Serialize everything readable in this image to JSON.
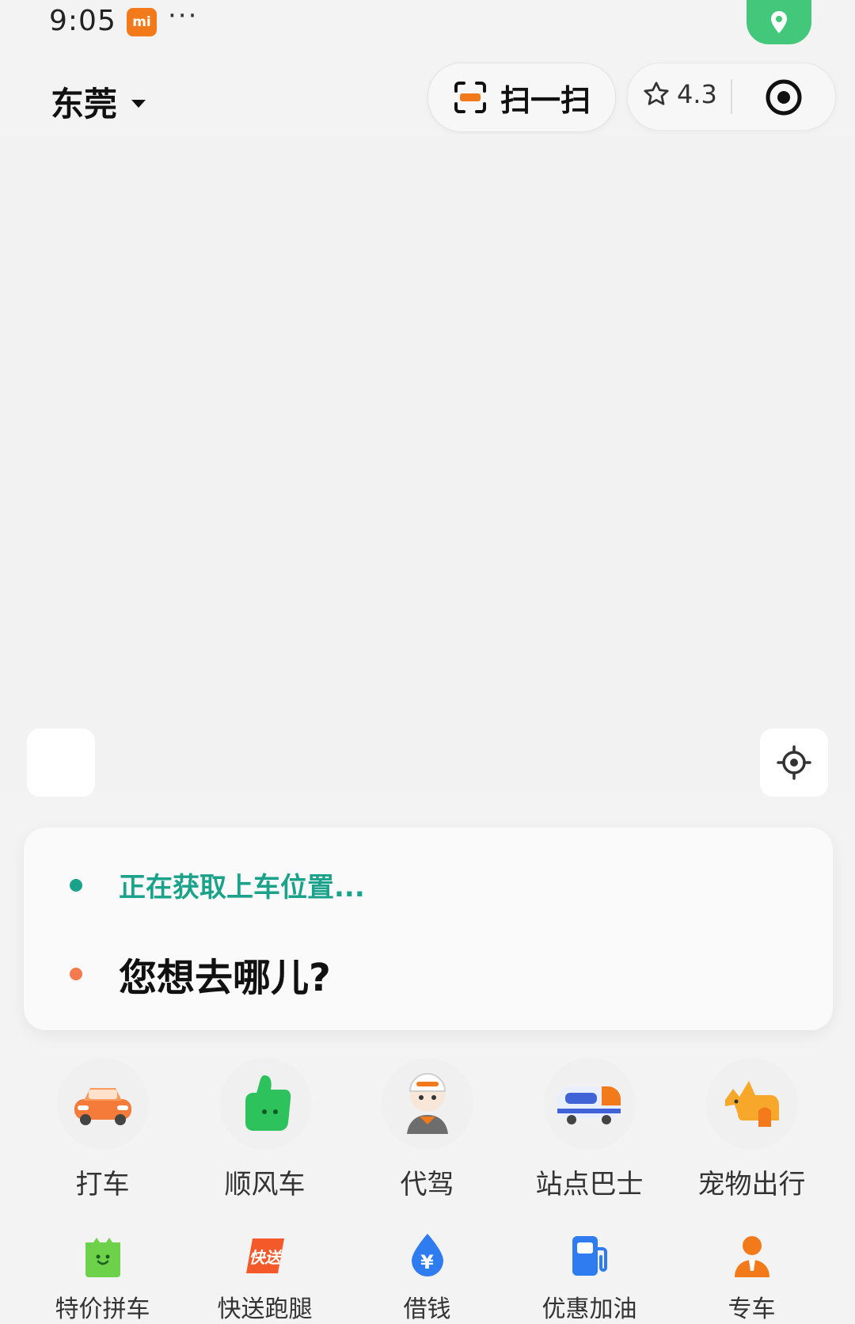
{
  "status_bar": {
    "time": "9:05",
    "badge": "mi",
    "more": "···"
  },
  "header": {
    "city": "东莞",
    "scan_label": "扫一扫",
    "rating": "4.3"
  },
  "trip": {
    "pickup_text": "正在获取上车位置...",
    "destination_placeholder": "您想去哪儿?",
    "pickup_dot_color": "#1aa38a",
    "dest_dot_color": "#f47b4e"
  },
  "services_primary": [
    {
      "label": "打车",
      "icon": "car-icon"
    },
    {
      "label": "顺风车",
      "icon": "thumbs-up-icon"
    },
    {
      "label": "代驾",
      "icon": "driver-icon"
    },
    {
      "label": "站点巴士",
      "icon": "bus-icon"
    },
    {
      "label": "宠物出行",
      "icon": "pet-icon"
    }
  ],
  "services_secondary": [
    {
      "label": "特价拼车",
      "icon": "green-bag-icon"
    },
    {
      "label": "快送跑腿",
      "icon": "express-icon",
      "badge": "快送"
    },
    {
      "label": "借钱",
      "icon": "yuan-drop-icon",
      "badge": "¥"
    },
    {
      "label": "优惠加油",
      "icon": "fuel-icon"
    },
    {
      "label": "专车",
      "icon": "chauffeur-icon"
    }
  ]
}
